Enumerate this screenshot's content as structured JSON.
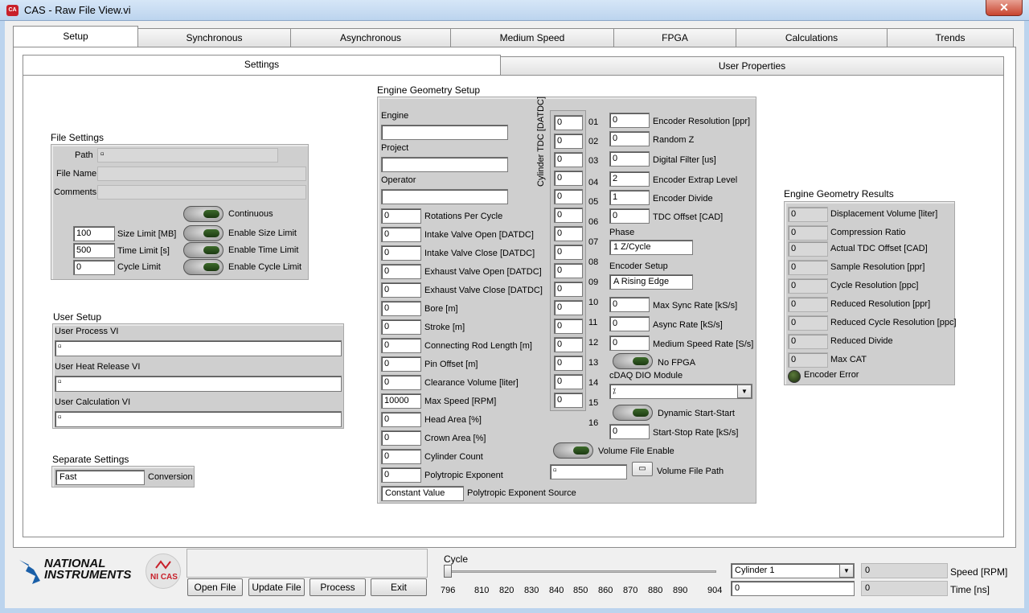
{
  "window": {
    "title": "CAS - Raw File View.vi",
    "app_icon": "CA",
    "close_glyph": "✕"
  },
  "tabs": [
    "Setup",
    "Synchronous",
    "Asynchronous",
    "Medium Speed",
    "FPGA",
    "Calculations",
    "Trends"
  ],
  "subtabs": [
    "Settings",
    "User Properties"
  ],
  "file_settings": {
    "title": "File Settings",
    "path_label": "Path",
    "filename_label": "File Name",
    "comments_label": "Comments",
    "continuous_label": "Continuous",
    "size_limit_value": "100",
    "size_limit_label": "Size Limit [MB]",
    "enable_size_label": "Enable Size Limit",
    "time_limit_value": "500",
    "time_limit_label": "Time Limit [s]",
    "enable_time_label": "Enable Time Limit",
    "cycle_limit_value": "0",
    "cycle_limit_label": "Cycle Limit",
    "enable_cycle_label": "Enable Cycle Limit"
  },
  "user_setup": {
    "title": "User Setup",
    "process_label": "User Process VI",
    "heat_label": "User Heat Release VI",
    "calc_label": "User Calculation VI"
  },
  "separate_settings": {
    "title": "Separate Settings",
    "value": "Fast",
    "label": "Conversion"
  },
  "engine_geometry": {
    "title": "Engine Geometry Setup",
    "engine_label": "Engine",
    "project_label": "Project",
    "operator_label": "Operator",
    "params": [
      {
        "value": "0",
        "label": "Rotations Per Cycle"
      },
      {
        "value": "0",
        "label": "Intake Valve Open [DATDC]"
      },
      {
        "value": "0",
        "label": "Intake Valve Close [DATDC]"
      },
      {
        "value": "0",
        "label": "Exhaust Valve Open [DATDC]"
      },
      {
        "value": "0",
        "label": "Exhaust Valve Close [DATDC]"
      },
      {
        "value": "0",
        "label": "Bore [m]"
      },
      {
        "value": "0",
        "label": "Stroke [m]"
      },
      {
        "value": "0",
        "label": "Connecting Rod Length [m]"
      },
      {
        "value": "0",
        "label": "Pin Offset [m]"
      },
      {
        "value": "0",
        "label": "Clearance Volume [liter]"
      },
      {
        "value": "10000",
        "label": "Max Speed [RPM]"
      },
      {
        "value": "0",
        "label": "Head Area [%]"
      },
      {
        "value": "0",
        "label": "Crown Area [%]"
      },
      {
        "value": "0",
        "label": "Cylinder Count"
      },
      {
        "value": "0",
        "label": "Polytropic Exponent"
      }
    ],
    "poly_source_value": "Constant Value",
    "poly_source_label": "Polytropic Exponent Source",
    "cyl_tdc_label": "Cylinder TDC [DATDC]",
    "cyl_values": [
      "0",
      "0",
      "0",
      "0",
      "0",
      "0",
      "0",
      "0",
      "0",
      "0",
      "0",
      "0",
      "0",
      "0",
      "0"
    ],
    "cyl_numbers": [
      "01",
      "02",
      "03",
      "04",
      "05",
      "06",
      "07",
      "08",
      "09",
      "10",
      "11",
      "12",
      "13",
      "14",
      "15",
      "16"
    ],
    "encoder": [
      {
        "value": "0",
        "label": "Encoder Resolution [ppr]"
      },
      {
        "value": "0",
        "label": "Random Z"
      },
      {
        "value": "0",
        "label": "Digital Filter [us]"
      },
      {
        "value": "2",
        "label": "Encoder Extrap Level"
      },
      {
        "value": "1",
        "label": "Encoder Divide"
      },
      {
        "value": "0",
        "label": "TDC Offset [CAD]"
      }
    ],
    "phase_label": "Phase",
    "phase_value": "1 Z/Cycle",
    "encoder_setup_label": "Encoder Setup",
    "encoder_setup_value": "A Rising Edge",
    "rates": [
      {
        "value": "0",
        "label": "Max Sync Rate [kS/s]"
      },
      {
        "value": "0",
        "label": "Async Rate [kS/s]"
      },
      {
        "value": "0",
        "label": "Medium Speed Rate [S/s]"
      }
    ],
    "no_fpga_label": "No FPGA",
    "cdaq_label": "cDAQ DIO Module",
    "dynamic_label": "Dynamic Start-Start",
    "start_stop_value": "0",
    "start_stop_label": "Start-Stop Rate [kS/s]",
    "volume_enable_label": "Volume File Enable",
    "volume_path_label": "Volume File Path"
  },
  "results": {
    "title": "Engine Geometry Results",
    "items": [
      {
        "value": "0",
        "label": "Displacement Volume [liter]"
      },
      {
        "value": "0",
        "label": "Compression Ratio"
      },
      {
        "value": "0",
        "label": "Actual TDC Offset [CAD]"
      },
      {
        "value": "0",
        "label": "Sample Resolution [ppr]"
      },
      {
        "value": "0",
        "label": "Cycle Resolution [ppc]"
      },
      {
        "value": "0",
        "label": "Reduced Resolution [ppr]"
      },
      {
        "value": "0",
        "label": "Reduced Cycle Resolution [ppc]"
      },
      {
        "value": "0",
        "label": "Reduced Divide"
      },
      {
        "value": "0",
        "label": "Max CAT"
      }
    ],
    "encoder_error_label": "Encoder Error"
  },
  "footer": {
    "ni_logo_line1": "NATIONAL",
    "ni_logo_line2": "INSTRUMENTS",
    "nicas_label": "NI CAS",
    "buttons": [
      "Open File",
      "Update File",
      "Process",
      "Exit"
    ],
    "cycle_label": "Cycle",
    "ticks": [
      "796",
      "810",
      "820",
      "830",
      "840",
      "850",
      "860",
      "870",
      "880",
      "890",
      "904"
    ],
    "cylinder_value": "Cylinder 1",
    "cycle_field_value": "0",
    "speed_value": "0",
    "speed_label": "Speed [RPM]",
    "time_value": "0",
    "time_label": "Time [ns]"
  }
}
